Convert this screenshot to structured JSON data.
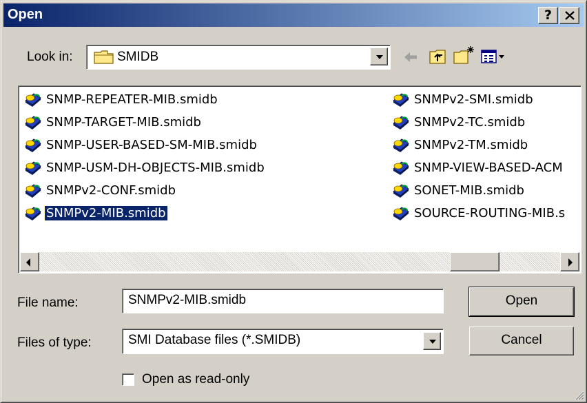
{
  "window": {
    "title": "Open",
    "help_label": "?",
    "close_label": "✕"
  },
  "lookin": {
    "label": "Look in:",
    "value": "SMIDB"
  },
  "toolbar": {
    "back_icon": "back-arrow-icon",
    "up_icon": "up-folder-icon",
    "newfolder_icon": "new-folder-icon",
    "view_icon": "view-menu-icon"
  },
  "files": {
    "col1": [
      "SNMP-REPEATER-MIB.smidb",
      "SNMP-TARGET-MIB.smidb",
      "SNMP-USER-BASED-SM-MIB.smidb",
      "SNMP-USM-DH-OBJECTS-MIB.smidb",
      "SNMPv2-CONF.smidb",
      "SNMPv2-MIB.smidb"
    ],
    "col2": [
      "SNMPv2-SMI.smidb",
      "SNMPv2-TC.smidb",
      "SNMPv2-TM.smidb",
      "SNMP-VIEW-BASED-ACM",
      "SONET-MIB.smidb",
      "SOURCE-ROUTING-MIB.s"
    ],
    "selected": "SNMPv2-MIB.smidb"
  },
  "filename": {
    "label": "File name:",
    "value": "SNMPv2-MIB.smidb"
  },
  "filetype": {
    "label": "Files of type:",
    "value": "SMI Database files (*.SMIDB)"
  },
  "readonly": {
    "label": "Open as read-only",
    "checked": false
  },
  "buttons": {
    "open": "Open",
    "cancel": "Cancel"
  },
  "colors": {
    "titlebar_start": "#0a246a",
    "titlebar_end": "#a6caf0",
    "face": "#d4d0c8",
    "selection": "#0a246a"
  }
}
